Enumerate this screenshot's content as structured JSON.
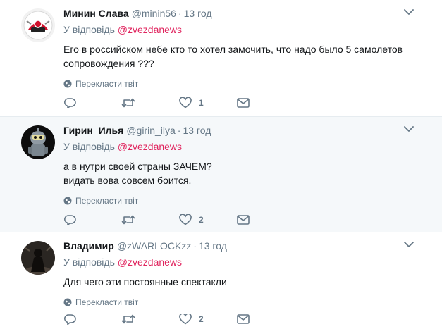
{
  "ui": {
    "reply_prefix": "У відповідь",
    "translate_label": "Перекласти твіт",
    "dot": "·"
  },
  "colors": {
    "mention": "#e0245e",
    "muted": "#657786",
    "hover_bg": "#f5f8fa"
  },
  "tweets": [
    {
      "fullname": "Минин Слава",
      "username": "@minin56",
      "time": "13 год",
      "reply_to": "@zvezdanews",
      "text": "Его в российском небе кто то хотел замочить, что надо было 5 самолетов сопровождения ???",
      "reply_count": "",
      "retweet_count": "",
      "like_count": "1",
      "avatar_icon": "avatar-red-logo-icon"
    },
    {
      "fullname": "Гирин_Илья",
      "username": "@girin_ilya",
      "time": "13 год",
      "reply_to": "@zvezdanews",
      "text_lines": [
        "а в нутри своей страны ЗАЧЕМ?",
        "видать вова совсем боится."
      ],
      "reply_count": "",
      "retweet_count": "",
      "like_count": "2",
      "avatar_icon": "avatar-robot-icon"
    },
    {
      "fullname": "Владимир",
      "username": "@zWARLOCKzz",
      "time": "13 год",
      "reply_to": "@zvezdanews",
      "text": "Для чего эти постоянные спектакли",
      "reply_count": "",
      "retweet_count": "",
      "like_count": "2",
      "avatar_icon": "avatar-dark-figure-icon"
    }
  ]
}
